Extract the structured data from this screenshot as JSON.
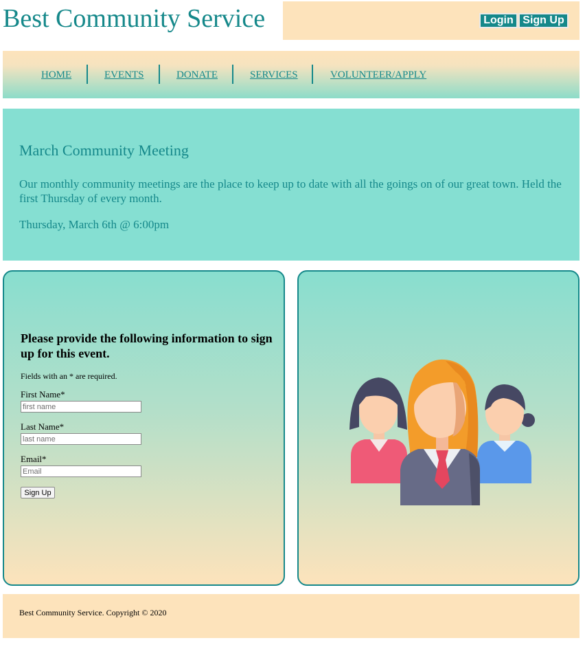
{
  "header": {
    "title": "Best Community Service",
    "login_label": "Login",
    "signup_label": "Sign Up"
  },
  "nav": {
    "items": [
      {
        "label": "HOME"
      },
      {
        "label": "EVENTS"
      },
      {
        "label": "DONATE"
      },
      {
        "label": "SERVICES"
      },
      {
        "label": "VOLUNTEER/APPLY"
      }
    ]
  },
  "event": {
    "title": "March Community Meeting",
    "description": "Our monthly community meetings are the place to keep up to date with all the goings on of our great town. Held the first Thursday of every month.",
    "datetime": "Thursday, March 6th @ 6:00pm"
  },
  "form": {
    "heading": "Please provide the following information to sign up for this event.",
    "note": "Fields with an * are required.",
    "fields": [
      {
        "label": "First Name*",
        "placeholder": "first name",
        "value": ""
      },
      {
        "label": "Last Name*",
        "placeholder": "last name",
        "value": ""
      },
      {
        "label": "Email*",
        "placeholder": "Email",
        "value": ""
      }
    ],
    "submit_label": "Sign Up"
  },
  "illustration": {
    "icon": "community-group-icon"
  },
  "footer": {
    "text": "Best Community Service. Copyright © 2020"
  },
  "colors": {
    "teal_accent": "#15888a",
    "peach": "#fde3bb",
    "mint": "#85dfd2"
  }
}
